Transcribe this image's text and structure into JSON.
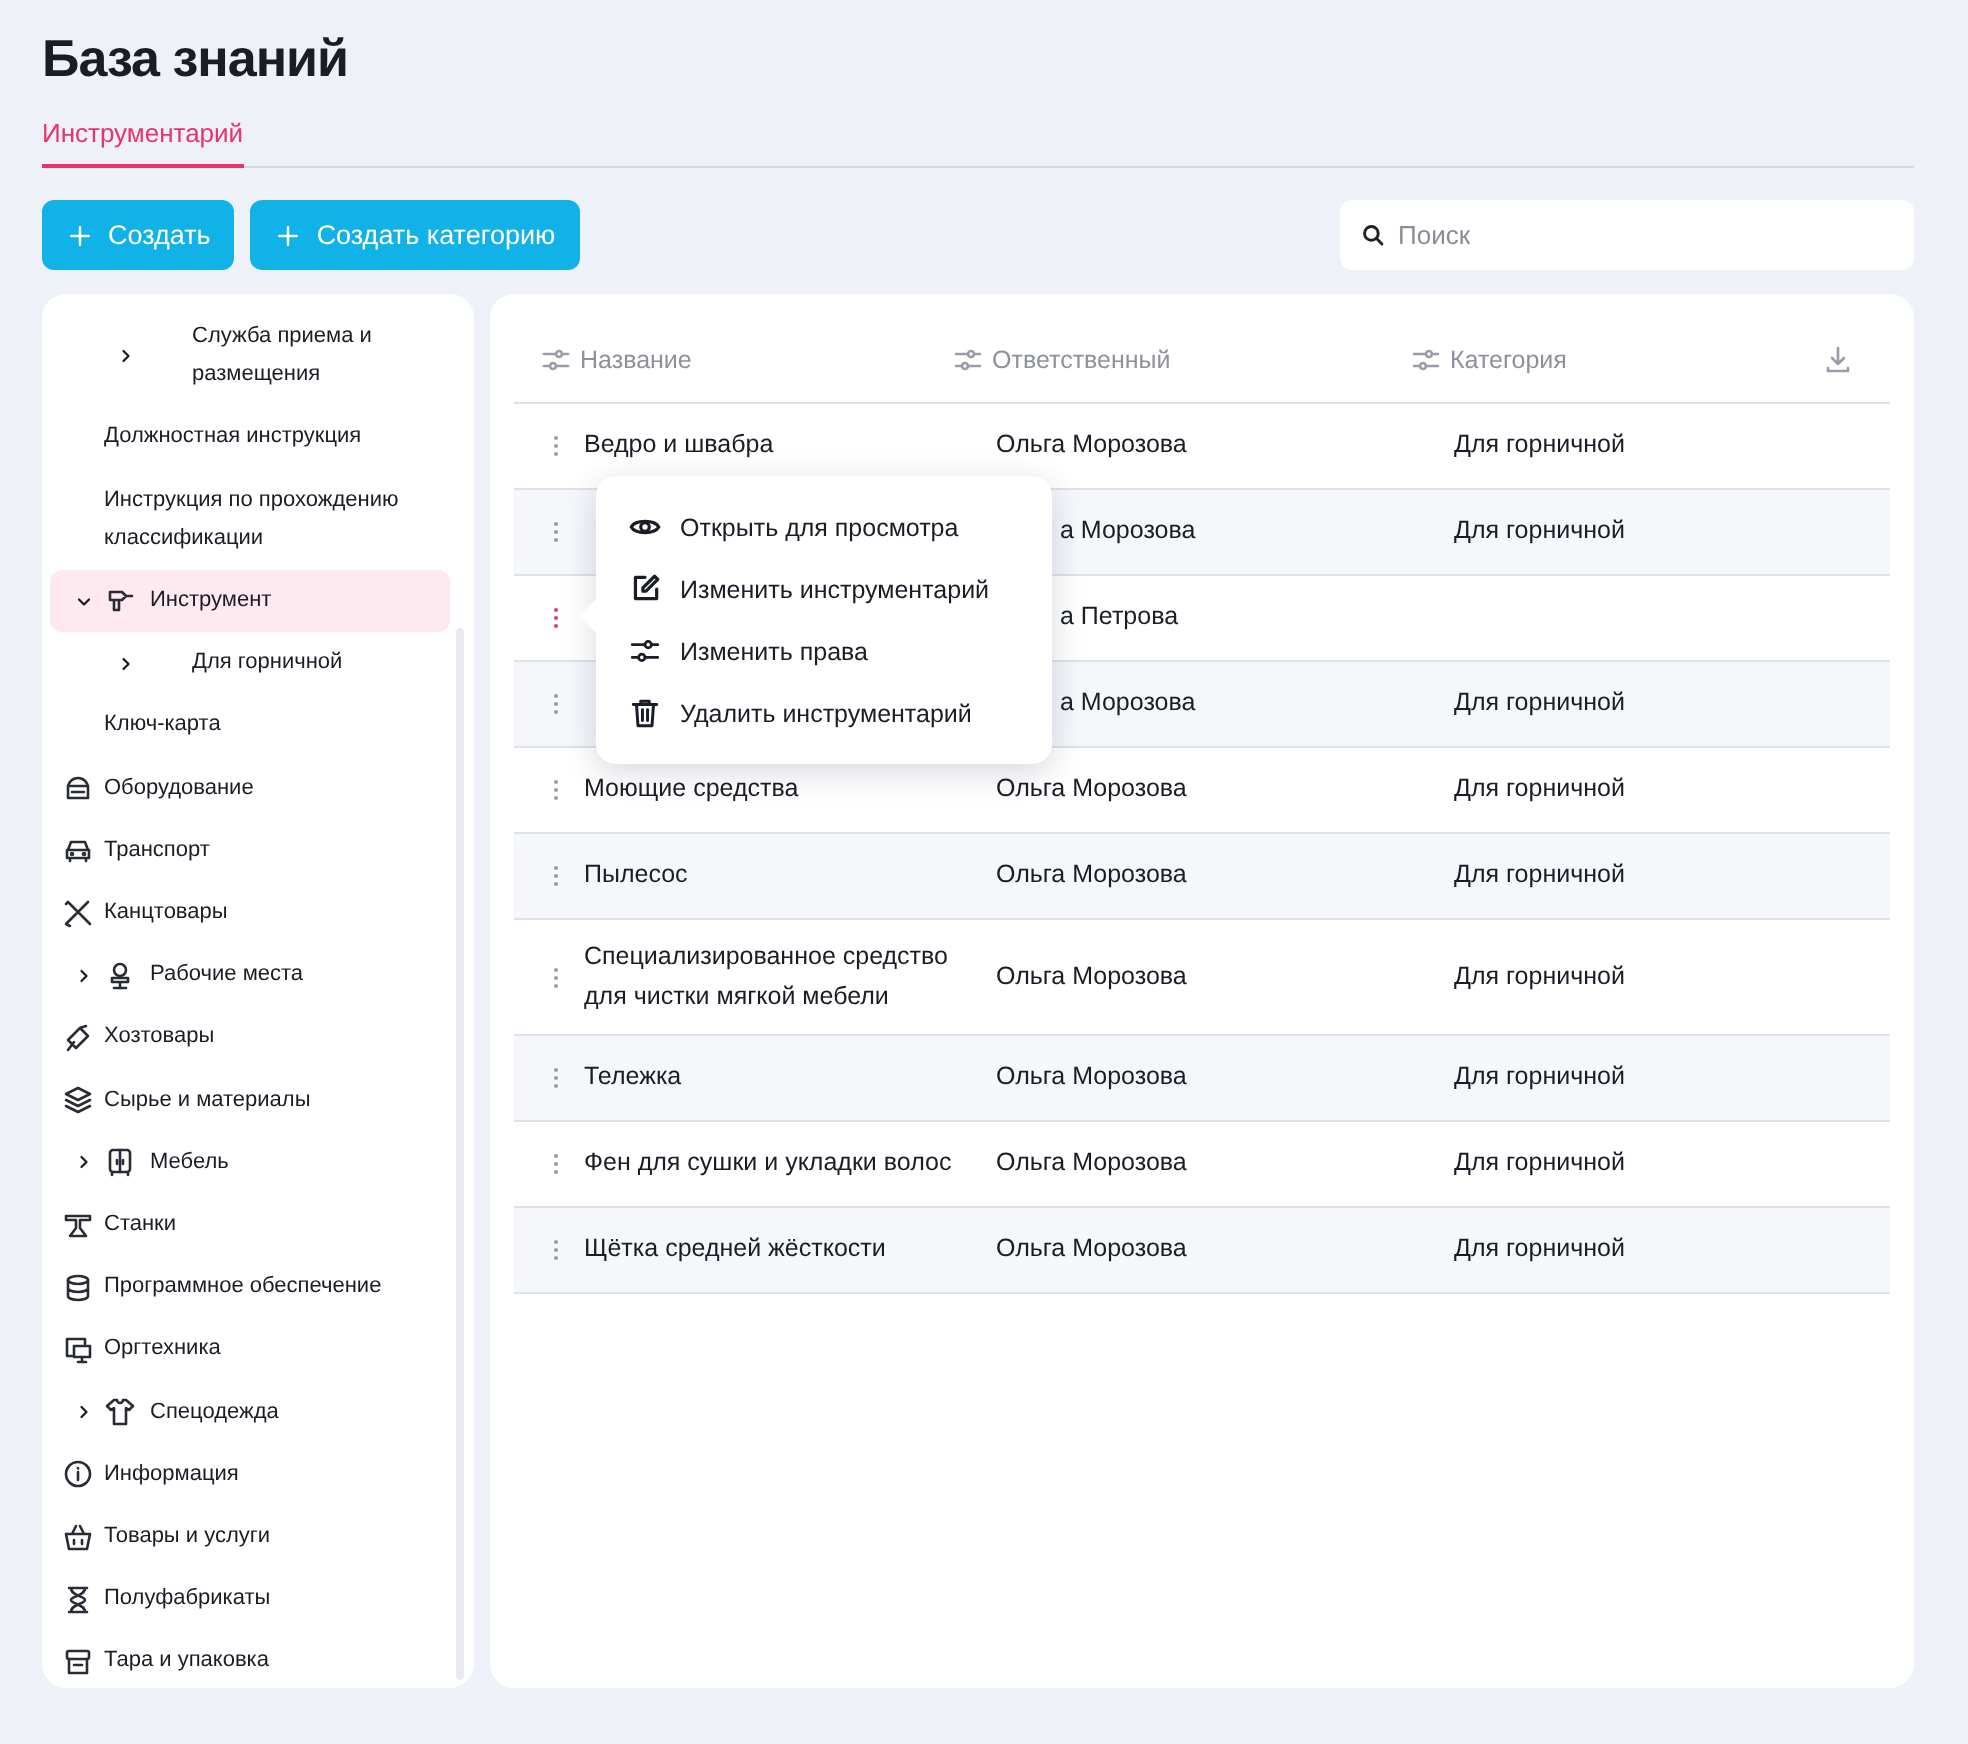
{
  "page": {
    "title": "База знаний"
  },
  "tabs": [
    {
      "label": "Инструментарий",
      "selected": true
    }
  ],
  "toolbar": {
    "buttons": [
      "Создать",
      "Создать категорию"
    ],
    "search": {
      "placeholder": "Поиск"
    }
  },
  "sidebar": {
    "items": [
      {
        "kind": "hidden-parent",
        "children": [
          {
            "label": "Служба приема и размещения",
            "expanded": false,
            "selected": false
          }
        ]
      },
      {
        "label": "Должностная инструкция",
        "selected": false
      },
      {
        "label": "Инструкция по прохождению классификации",
        "selected": false
      },
      {
        "label": "Инструмент",
        "expanded": true,
        "selected": true,
        "children": [
          {
            "label": "Для горничной",
            "expanded": false,
            "selected": false
          }
        ]
      },
      {
        "label": "Ключ-карта",
        "selected": false
      },
      {
        "label": "Оборудование",
        "selected": false
      },
      {
        "label": "Транспорт",
        "selected": false
      },
      {
        "label": "Канцтовары",
        "selected": false
      },
      {
        "label": "Рабочие места",
        "expanded": false,
        "selected": false
      },
      {
        "label": "Хозтовары",
        "selected": false
      },
      {
        "label": "Сырье и материалы",
        "selected": false
      },
      {
        "label": "Мебель",
        "expanded": false,
        "selected": false
      },
      {
        "label": "Станки",
        "selected": false
      },
      {
        "label": "Программное обеспечение",
        "selected": false
      },
      {
        "label": "Оргтехника",
        "selected": false
      },
      {
        "label": "Спецодежда",
        "expanded": false,
        "selected": false
      },
      {
        "label": "Информация",
        "selected": false
      },
      {
        "label": "Товары и услуги",
        "selected": false
      },
      {
        "label": "Полуфабрикаты",
        "selected": false
      },
      {
        "label": "Тара и упаковка",
        "selected": false
      }
    ]
  },
  "table": {
    "columns": [
      "Название",
      "Ответственный",
      "Категория"
    ],
    "rows": [
      {
        "name": "Ведро и швабра",
        "responsible": "Ольга Морозова",
        "category": "Для горничной",
        "menu_open": false,
        "behind_menu": false
      },
      {
        "responsible": "а Морозова",
        "category": "Для горничной",
        "menu_open": false,
        "behind_menu": true
      },
      {
        "responsible": "а Петрова",
        "menu_open": true,
        "behind_menu": true
      },
      {
        "responsible": "а Морозова",
        "category": "Для горничной",
        "menu_open": false,
        "behind_menu": true
      },
      {
        "name": "Моющие средства",
        "responsible": "Ольга Морозова",
        "category": "Для горничной",
        "menu_open": false,
        "behind_menu": false
      },
      {
        "name": "Пылесос",
        "responsible": "Ольга Морозова",
        "category": "Для горничной",
        "menu_open": false,
        "behind_menu": false
      },
      {
        "name": "Специализированное средство для чистки мягкой мебели",
        "responsible": "Ольга Морозова",
        "category": "Для горничной",
        "menu_open": false,
        "behind_menu": false
      },
      {
        "name": "Тележка",
        "responsible": "Ольга Морозова",
        "category": "Для горничной",
        "menu_open": false,
        "behind_menu": false
      },
      {
        "name": "Фен для сушки и укладки волос",
        "responsible": "Ольга Морозова",
        "category": "Для горничной",
        "menu_open": false,
        "behind_menu": false
      },
      {
        "name": "Щётка средней жёсткости",
        "responsible": "Ольга Морозова",
        "category": "Для горничной",
        "menu_open": false,
        "behind_menu": false
      }
    ]
  },
  "context_menu": {
    "items": [
      {
        "kind": "view",
        "label": "Открыть для просмотра"
      },
      {
        "kind": "edit",
        "label": "Изменить инструментарий"
      },
      {
        "kind": "rights",
        "label": "Изменить права"
      },
      {
        "kind": "delete",
        "label": "Удалить инструментарий"
      }
    ]
  }
}
